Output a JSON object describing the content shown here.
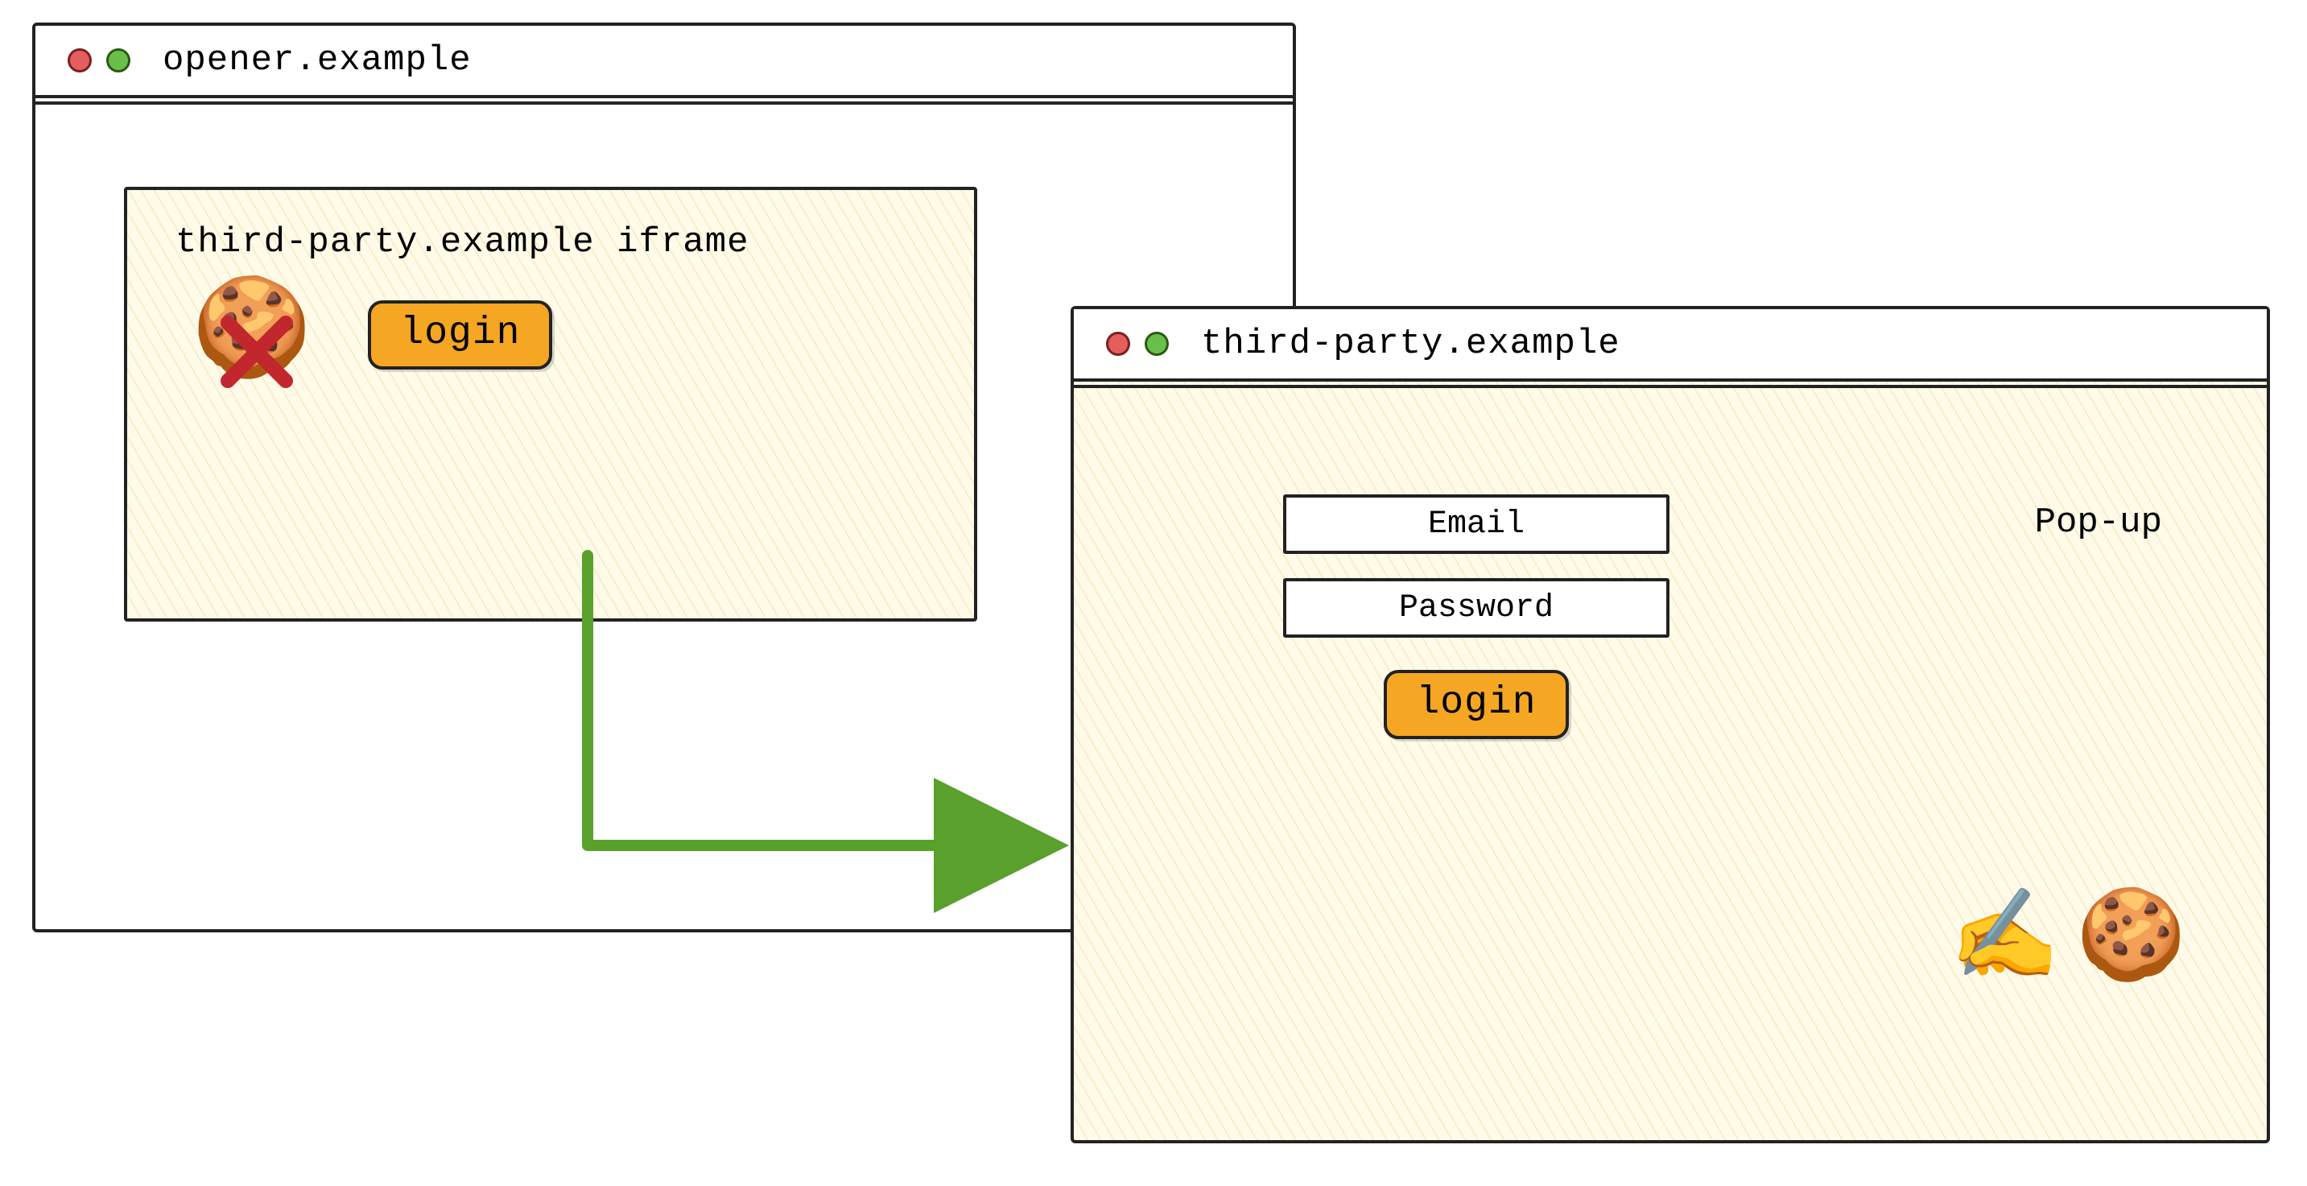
{
  "opener_window": {
    "url": "opener.example",
    "iframe": {
      "label": "third-party.example iframe",
      "login_button": "login",
      "cookie_icon": "🍪",
      "cookie_blocked": true
    }
  },
  "popup_window": {
    "url": "third-party.example",
    "popup_label": "Pop-up",
    "email_placeholder": "Email",
    "password_placeholder": "Password",
    "login_button": "login",
    "writing_icon": "✍️",
    "cookie_icon": "🍪"
  },
  "colors": {
    "button": "#f5a623",
    "arrow": "#5aa02c",
    "cross": "#c1272d"
  }
}
